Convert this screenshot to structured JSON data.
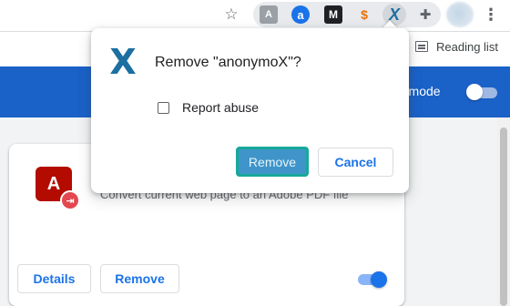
{
  "toolbar": {
    "icons": [
      "star-icon",
      "pdf-extension-icon",
      "a-extension-icon",
      "m-extension-icon",
      "orange-extension-icon",
      "anonymox-extension-icon",
      "puzzle-icon",
      "avatar",
      "menu-dots-icon"
    ],
    "star_glyph": "☆",
    "pdf_glyph": "A",
    "a_glyph": "a",
    "m_glyph": "M",
    "orange_glyph": "$",
    "x_glyph": "X",
    "puzzle_glyph": "✚",
    "menu_glyph": "⋮"
  },
  "bookmarks": {
    "reading_list_label": "Reading list"
  },
  "header": {
    "dev_mode_label": "r mode",
    "color": "#1a61c8"
  },
  "extension_card": {
    "description": "Convert current web page to an Adobe PDF file",
    "details_label": "Details",
    "remove_label": "Remove",
    "enabled": true,
    "icon_glyph": "A"
  },
  "dialog": {
    "logo_glyph": "X",
    "title": "Remove \"anonymoX\"?",
    "checkbox_label": "Report abuse",
    "checkbox_checked": false,
    "remove_label": "Remove",
    "cancel_label": "Cancel",
    "remove_highlight_color": "#16a89a"
  }
}
